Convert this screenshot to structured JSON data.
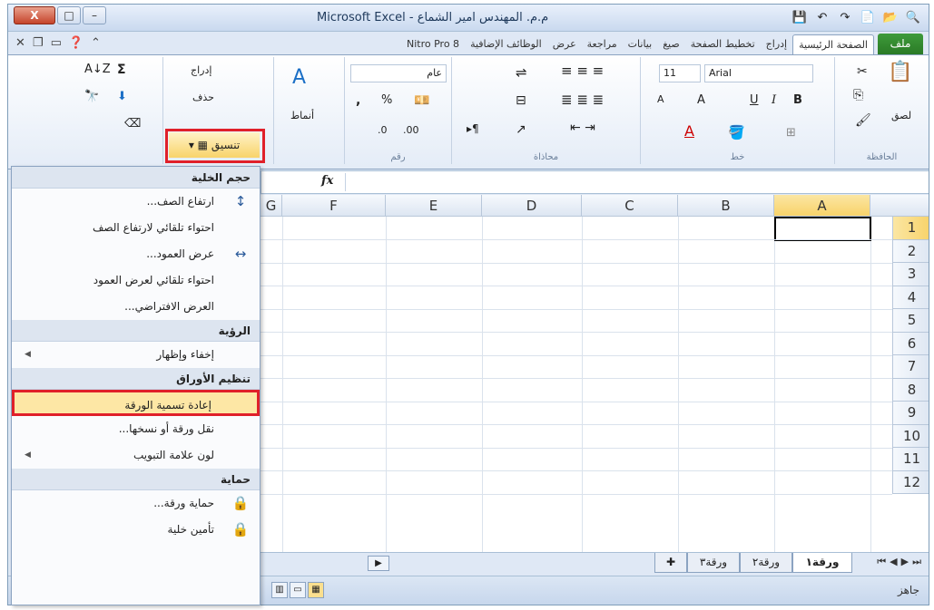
{
  "window": {
    "title": "م.م. المهندس امير الشماع - Microsoft Excel",
    "close_label": "X",
    "max_glyph": "□",
    "min_glyph": "–"
  },
  "quick_access": [
    "💾",
    "↶",
    "↷",
    "📄",
    "📂",
    "🔍"
  ],
  "tabs": {
    "file": "ملف",
    "items": [
      "الصفحة الرئيسية",
      "إدراج",
      "تخطيط الصفحة",
      "صيغ",
      "بيانات",
      "مراجعة",
      "عرض",
      "الوظائف الإضافية",
      "Nitro Pro 8"
    ]
  },
  "ribbon": {
    "clipboard": {
      "label": "الحافظة",
      "paste": "لصق"
    },
    "font": {
      "label": "خط",
      "name": "Arial",
      "size": "11",
      "bold": "B",
      "italic": "I",
      "underline": "U"
    },
    "alignment": {
      "label": "محاذاة"
    },
    "number": {
      "label": "رقم",
      "format": "عام",
      "percent": "%",
      "comma": ","
    },
    "styles": {
      "label": "أنماط"
    },
    "cells": {
      "insert": "إدراج",
      "delete": "حذف",
      "format": "تنسيق"
    },
    "editing": {
      "sum": "Σ",
      "sort": "A↓Z"
    }
  },
  "formula_bar": {
    "fx": "fx",
    "value": ""
  },
  "columns": [
    "A",
    "B",
    "C",
    "D",
    "E",
    "F",
    "G"
  ],
  "rows": [
    "1",
    "2",
    "3",
    "4",
    "5",
    "6",
    "7",
    "8",
    "9",
    "10",
    "11",
    "12"
  ],
  "selected_cell": "A1",
  "sheets": [
    "ورقة١",
    "ورقة٢",
    "ورقة٣"
  ],
  "status": {
    "ready": "جاهز"
  },
  "format_menu": {
    "sections": [
      {
        "header": "حجم الخلية",
        "items": [
          {
            "label": "ارتفاع الصف...",
            "icon": "row-height-icon"
          },
          {
            "label": "احتواء تلقائي لارتفاع الصف"
          },
          {
            "label": "عرض العمود...",
            "icon": "column-width-icon"
          },
          {
            "label": "احتواء تلقائي لعرض العمود"
          },
          {
            "label": "العرض الافتراضي..."
          }
        ]
      },
      {
        "header": "الرؤية",
        "items": [
          {
            "label": "إخفاء وإظهار",
            "submenu": true
          }
        ]
      },
      {
        "header": "تنظيم الأوراق",
        "items": [
          {
            "label": "إعادة تسمية الورقة",
            "highlighted": true
          },
          {
            "label": "نقل ورقة أو نسخها..."
          },
          {
            "label": "لون علامة التبويب",
            "submenu": true
          }
        ]
      },
      {
        "header": "حماية",
        "items": [
          {
            "label": "حماية ورقة...",
            "icon": "protect-sheet-icon"
          },
          {
            "label": "تأمين خلية",
            "icon": "lock-cell-icon"
          }
        ]
      }
    ]
  },
  "colors": {
    "highlight_border": "#e0202a",
    "file_tab": "#2a7a26",
    "selection": "#fbe6a3"
  }
}
